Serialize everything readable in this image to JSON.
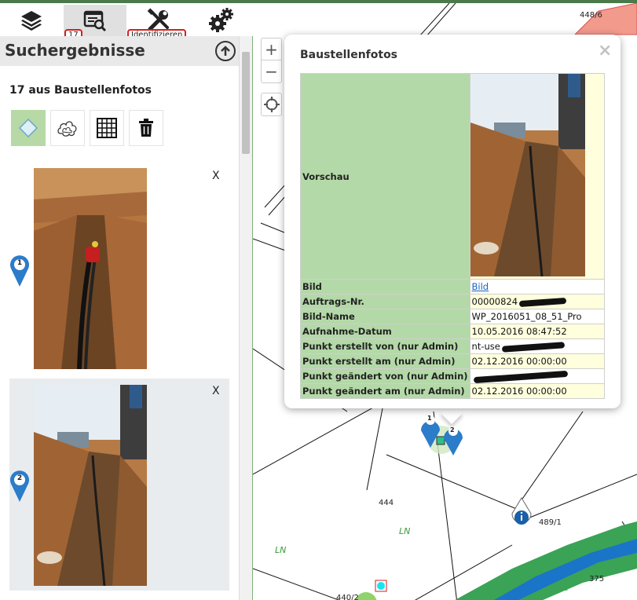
{
  "toolbar": {
    "results_badge": "17",
    "identify_badge": "Identifizieren"
  },
  "panel": {
    "title": "Suchergebnisse",
    "count_label": "17 aus Baustellenfotos",
    "results": [
      {
        "marker": "1",
        "close": "X"
      },
      {
        "marker": "2",
        "close": "X"
      }
    ]
  },
  "map": {
    "zoom_in": "+",
    "zoom_out": "−",
    "parcel_labels": [
      "448/6",
      "444",
      "489/1",
      "375",
      "440/2"
    ],
    "area_labels": [
      "LN",
      "LN"
    ],
    "markers": [
      "1",
      "2"
    ]
  },
  "popup": {
    "title": "Baustellenfotos",
    "close": "×",
    "preview_label": "Vorschau",
    "rows": [
      {
        "key": "Bild",
        "value": "Bild",
        "link": true
      },
      {
        "key": "Auftrags-Nr.",
        "value": "00000824"
      },
      {
        "key": "Bild-Name",
        "value": "WP_2016051_08_51_Pro"
      },
      {
        "key": "Aufnahme-Datum",
        "value": "10.05.2016 08:47:52"
      },
      {
        "key": "Punkt erstellt von (nur Admin)",
        "value": "nt-use"
      },
      {
        "key": "Punkt erstellt am (nur Admin)",
        "value": "02.12.2016 00:00:00"
      },
      {
        "key": "Punkt geändert von (nur Admin)",
        "value": ""
      },
      {
        "key": "Punkt geändert am (nur Admin)",
        "value": "02.12.2016 00:00:00"
      }
    ]
  },
  "colors": {
    "accent_green": "#b4d9a8",
    "value_yellow": "#ffffdd",
    "marker_blue": "#2b7cc9",
    "badge_red": "#d61e1e",
    "water_blue": "#1a74c8",
    "meadow_green": "#3aa356"
  }
}
